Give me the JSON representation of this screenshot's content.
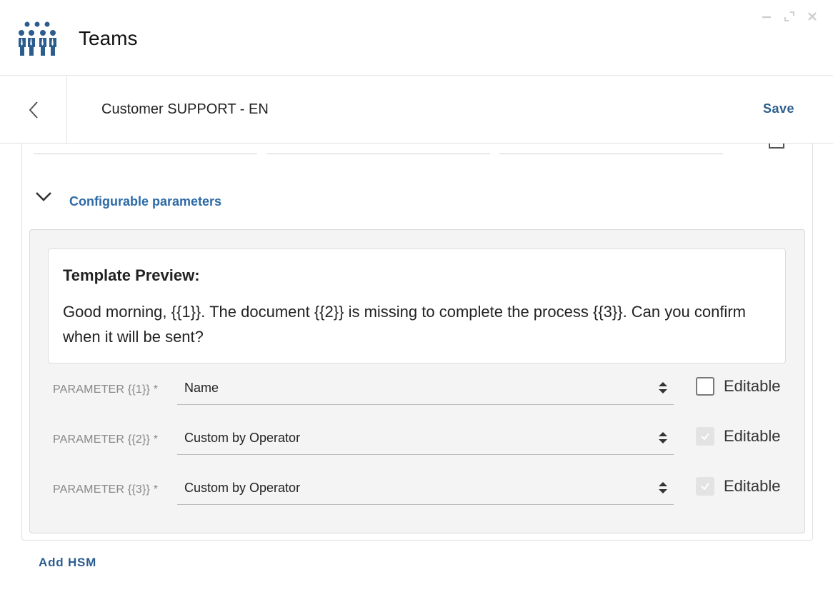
{
  "app": {
    "title": "Teams",
    "brand_color": "#2c5d8f",
    "logo_icon": "team-people-icon"
  },
  "window_controls": {
    "minimize_icon": "minimize-icon",
    "maximize_icon": "maximize-icon",
    "close_icon": "close-icon"
  },
  "subheader": {
    "back_icon": "chevron-left-icon",
    "title": "Customer SUPPORT - EN",
    "save_label": "Save"
  },
  "section": {
    "toggle_icon": "chevron-down-icon",
    "label": "Configurable parameters"
  },
  "preview": {
    "title": "Template Preview:",
    "text": "Good morning, {{1}}. The document {{2}} is missing to complete the process {{3}}. Can you confirm when it will be sent?"
  },
  "parameters": [
    {
      "label": "PARAMETER {{1}} *",
      "value": "Name",
      "editable_label": "Editable",
      "editable_checked": false,
      "editable_disabled": false
    },
    {
      "label": "PARAMETER {{2}} *",
      "value": "Custom by Operator",
      "editable_label": "Editable",
      "editable_checked": true,
      "editable_disabled": true
    },
    {
      "label": "PARAMETER {{3}} *",
      "value": "Custom by Operator",
      "editable_label": "Editable",
      "editable_checked": true,
      "editable_disabled": true
    }
  ],
  "footer": {
    "add_label": "Add HSM"
  }
}
